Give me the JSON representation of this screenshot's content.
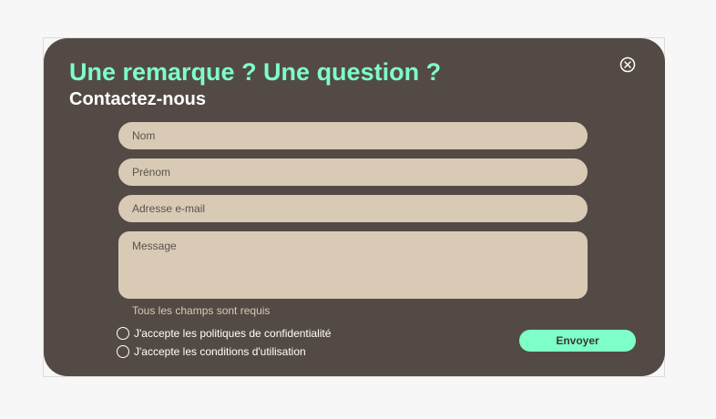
{
  "modal": {
    "title": "Une remarque ? Une question ?",
    "subtitle": "Contactez-nous",
    "close_icon": "close-circle-icon"
  },
  "form": {
    "name_placeholder": "Nom",
    "firstname_placeholder": "Prénom",
    "email_placeholder": "Adresse e-mail",
    "message_placeholder": "Message",
    "required_hint": "Tous les champs sont requis",
    "privacy_label": "J'accepte les politiques de confidentialité",
    "terms_label": "J'accepte les conditions d'utilisation",
    "submit_label": "Envoyer"
  },
  "colors": {
    "modal_bg": "#544a45",
    "accent": "#7dffc7",
    "field_bg": "#d8cab4",
    "page_bg": "#f7f7f7"
  }
}
